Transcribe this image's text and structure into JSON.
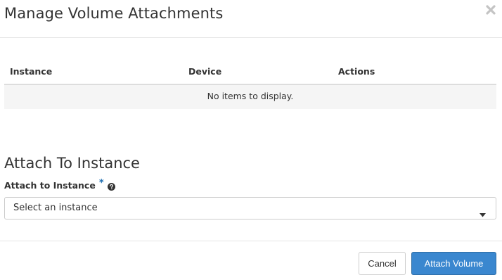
{
  "modal": {
    "title": "Manage Volume Attachments",
    "close_icon": "close-icon"
  },
  "attachments_table": {
    "columns": [
      "Instance",
      "Device",
      "Actions"
    ],
    "empty_message": "No items to display."
  },
  "attach_section": {
    "title": "Attach To Instance",
    "field_label": "Attach to Instance",
    "required_marker": "*",
    "help_icon": "question-circle-icon",
    "select": {
      "selected_value": "Select an instance",
      "caret_icon": "caret-down-icon"
    }
  },
  "footer": {
    "cancel_label": "Cancel",
    "submit_label": "Attach Volume"
  },
  "colors": {
    "primary": "#3a87cf",
    "required": "#1f6fb2",
    "empty_row_bg": "#f5f5f5"
  }
}
